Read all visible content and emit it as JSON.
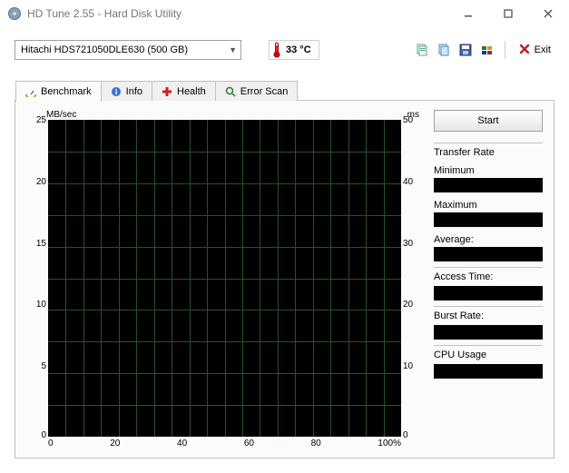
{
  "window": {
    "title": "HD Tune 2.55 - Hard Disk Utility"
  },
  "toolbar": {
    "drive_selected": "Hitachi HDS721050DLE630 (500 GB)",
    "temperature": "33 °C",
    "exit_label": "Exit"
  },
  "tabs": [
    {
      "id": "benchmark",
      "label": "Benchmark",
      "active": true
    },
    {
      "id": "info",
      "label": "Info",
      "active": false
    },
    {
      "id": "health",
      "label": "Health",
      "active": false
    },
    {
      "id": "errorscan",
      "label": "Error Scan",
      "active": false
    }
  ],
  "benchmark": {
    "start_label": "Start",
    "transfer_rate_label": "Transfer Rate",
    "min_label": "Minimum",
    "max_label": "Maximum",
    "avg_label": "Average:",
    "access_label": "Access Time:",
    "burst_label": "Burst Rate:",
    "cpu_label": "CPU Usage"
  },
  "chart_data": {
    "type": "line",
    "title": "",
    "y_left_label": "MB/sec",
    "y_right_label": "ms",
    "xlabel": "",
    "x_ticks": [
      0,
      20,
      40,
      60,
      80,
      100
    ],
    "x_unit": "%",
    "y_left_ticks": [
      25,
      20,
      15,
      10,
      5,
      0
    ],
    "y_right_ticks": [
      50,
      40,
      30,
      20,
      10,
      0
    ],
    "series": [
      {
        "name": "Transfer Rate (MB/sec)",
        "axis": "left",
        "values": []
      },
      {
        "name": "Access Time (ms)",
        "axis": "right",
        "values": []
      }
    ],
    "xlim": [
      0,
      100
    ],
    "ylim_left": [
      0,
      25
    ],
    "ylim_right": [
      0,
      50
    ]
  }
}
